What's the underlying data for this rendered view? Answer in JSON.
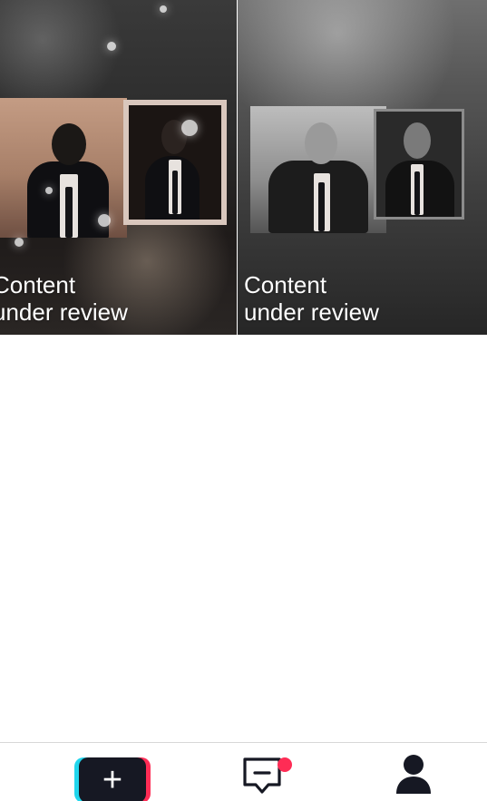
{
  "feed": {
    "tiles": [
      {
        "status_line_1": "Content",
        "status_line_2": "under review"
      },
      {
        "status_line_1": "Content",
        "status_line_2": "under review"
      }
    ]
  },
  "bottom_nav": {
    "create_symbol": "+",
    "inbox_has_notification": true,
    "icons": {
      "create": "plus-icon",
      "inbox": "message-icon",
      "profile": "person-icon"
    }
  },
  "colors": {
    "accent_red": "#fe2c55",
    "accent_cyan": "#20d5ec",
    "dark": "#161823",
    "background": "#ffffff"
  }
}
